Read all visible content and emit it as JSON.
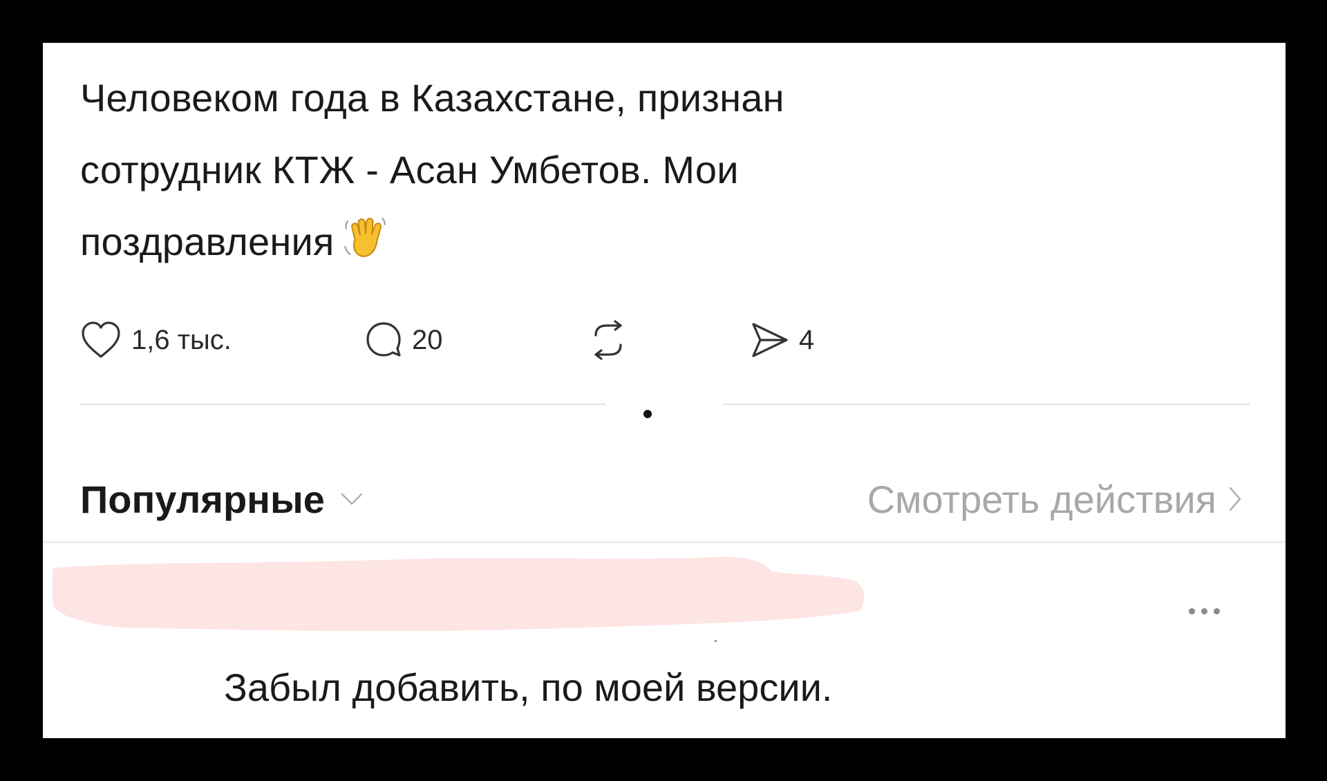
{
  "post": {
    "text_lines": [
      "Человеком года в Казахстане, признан",
      "сотрудник КТЖ - Асан Умбетов. Мои",
      "поздравления"
    ],
    "emoji": "waving-hand-icon"
  },
  "actions": {
    "likes": "1,6 тыс.",
    "comments": "20",
    "reposts": "",
    "shares": "4"
  },
  "replies_header": {
    "sort_label": "Популярные",
    "activity_link": "Смотреть действия"
  },
  "reply": {
    "text": "Забыл добавить, по моей версии."
  },
  "colors": {
    "background": "#000000",
    "card": "#ffffff",
    "text": "#1a1a1a",
    "muted": "#a8a8a8",
    "redaction": "#fde5e4"
  }
}
